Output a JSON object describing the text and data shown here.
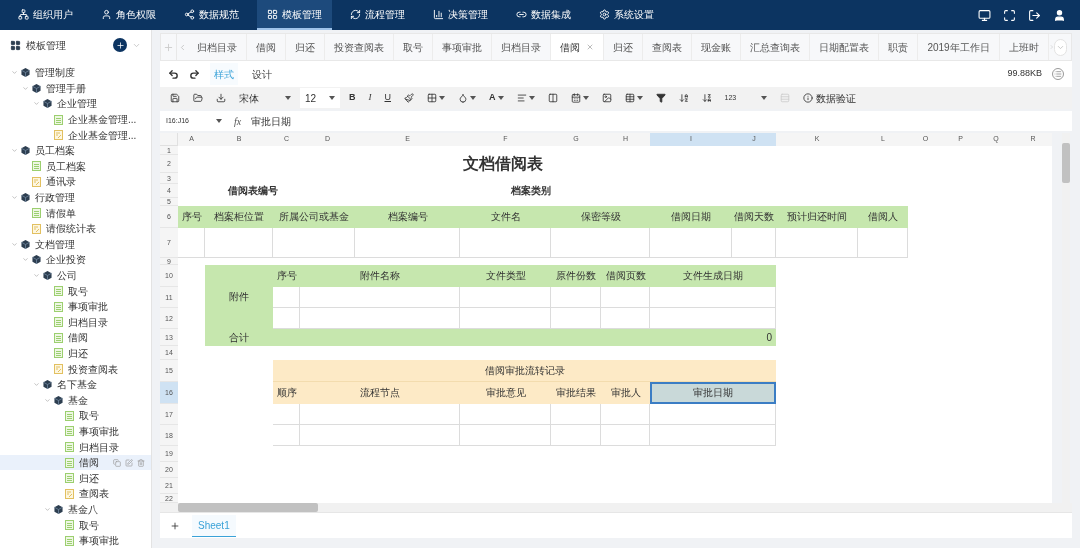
{
  "nav": {
    "items": [
      {
        "label": "组织用户",
        "selected": false
      },
      {
        "label": "角色权限",
        "selected": false
      },
      {
        "label": "数据规范",
        "selected": false
      },
      {
        "label": "模板管理",
        "selected": true
      },
      {
        "label": "流程管理",
        "selected": false
      },
      {
        "label": "决策管理",
        "selected": false
      },
      {
        "label": "数据集成",
        "selected": false
      },
      {
        "label": "系统设置",
        "selected": false
      }
    ]
  },
  "sidebar": {
    "title": "模板管理",
    "tree": [
      {
        "label": "管理制度",
        "kind": "folder",
        "expanded": true,
        "selected": false,
        "children": [
          {
            "label": "管理手册",
            "kind": "folder",
            "expanded": true,
            "selected": false,
            "children": [
              {
                "label": "企业管理",
                "kind": "folder",
                "expanded": true,
                "selected": false,
                "children": [
                  {
                    "label": "企业基金管理...",
                    "kind": "sheet",
                    "selected": false
                  },
                  {
                    "label": "企业基金管理...",
                    "kind": "form",
                    "selected": false
                  }
                ]
              }
            ]
          }
        ]
      },
      {
        "label": "员工档案",
        "kind": "folder",
        "expanded": true,
        "selected": false,
        "children": [
          {
            "label": "员工档案",
            "kind": "sheet",
            "selected": false
          },
          {
            "label": "通讯录",
            "kind": "form",
            "selected": false
          }
        ]
      },
      {
        "label": "行政管理",
        "kind": "folder",
        "expanded": true,
        "selected": false,
        "children": [
          {
            "label": "请假单",
            "kind": "sheet",
            "selected": false
          },
          {
            "label": "请假统计表",
            "kind": "form",
            "selected": false
          }
        ]
      },
      {
        "label": "文档管理",
        "kind": "folder",
        "expanded": true,
        "selected": false,
        "children": [
          {
            "label": "企业投资",
            "kind": "folder",
            "expanded": true,
            "selected": false,
            "children": [
              {
                "label": "公司",
                "kind": "folder",
                "expanded": true,
                "selected": false,
                "children": [
                  {
                    "label": "取号",
                    "kind": "sheet",
                    "selected": false
                  },
                  {
                    "label": "事项审批",
                    "kind": "sheet",
                    "selected": false
                  },
                  {
                    "label": "归档目录",
                    "kind": "sheet",
                    "selected": false
                  },
                  {
                    "label": "借阅",
                    "kind": "sheet",
                    "selected": false
                  },
                  {
                    "label": "归还",
                    "kind": "sheet",
                    "selected": false
                  },
                  {
                    "label": "投资查阅表",
                    "kind": "form",
                    "selected": false
                  }
                ]
              },
              {
                "label": "名下基金",
                "kind": "folder",
                "expanded": true,
                "selected": false,
                "children": [
                  {
                    "label": "基金",
                    "kind": "folder",
                    "expanded": true,
                    "selected": false,
                    "children": [
                      {
                        "label": "取号",
                        "kind": "sheet",
                        "selected": false
                      },
                      {
                        "label": "事项审批",
                        "kind": "sheet",
                        "selected": false
                      },
                      {
                        "label": "归档目录",
                        "kind": "sheet",
                        "selected": false
                      },
                      {
                        "label": "借阅",
                        "kind": "sheet",
                        "selected": true
                      },
                      {
                        "label": "归还",
                        "kind": "sheet",
                        "selected": false
                      },
                      {
                        "label": "查阅表",
                        "kind": "form",
                        "selected": false
                      }
                    ]
                  },
                  {
                    "label": "基金八",
                    "kind": "folder",
                    "expanded": true,
                    "selected": false,
                    "children": [
                      {
                        "label": "取号",
                        "kind": "sheet",
                        "selected": false
                      },
                      {
                        "label": "事项审批",
                        "kind": "sheet",
                        "selected": false
                      }
                    ]
                  }
                ]
              }
            ]
          }
        ]
      }
    ]
  },
  "tabs": {
    "items": [
      {
        "label": "归档目录",
        "selected": false
      },
      {
        "label": "借阅",
        "selected": false
      },
      {
        "label": "归还",
        "selected": false
      },
      {
        "label": "投资查阅表",
        "selected": false
      },
      {
        "label": "取号",
        "selected": false
      },
      {
        "label": "事项审批",
        "selected": false
      },
      {
        "label": "归档目录",
        "selected": false
      },
      {
        "label": "借阅",
        "selected": true
      },
      {
        "label": "归还",
        "selected": false
      },
      {
        "label": "查阅表",
        "selected": false
      },
      {
        "label": "现金账",
        "selected": false
      },
      {
        "label": "汇总查询表",
        "selected": false
      },
      {
        "label": "日期配置表",
        "selected": false
      },
      {
        "label": "职责",
        "selected": false
      },
      {
        "label": "2019年工作日",
        "selected": false
      },
      {
        "label": "上班时",
        "selected": false
      }
    ]
  },
  "modes": [
    {
      "label": "样式",
      "selected": true
    },
    {
      "label": "设计",
      "selected": false
    }
  ],
  "file_size": "99.88KB",
  "toolbar": {
    "font": "宋体",
    "font_size": "12",
    "bold": "B",
    "italic": "I",
    "underline": "U",
    "font_color": "A",
    "number_format": "123",
    "validation": "数据验证"
  },
  "formula_bar": {
    "cell_ref": "I16:J16",
    "fx": "fx",
    "value": "审批日期"
  },
  "sheet": {
    "column_headers": [
      {
        "label": "A",
        "selected": false
      },
      {
        "label": "B",
        "selected": false
      },
      {
        "label": "C",
        "selected": false
      },
      {
        "label": "D",
        "selected": false
      },
      {
        "label": "E",
        "selected": false
      },
      {
        "label": "F",
        "selected": false
      },
      {
        "label": "G",
        "selected": false
      },
      {
        "label": "H",
        "selected": false
      },
      {
        "label": "I",
        "selected": true
      },
      {
        "label": "J",
        "selected": true
      },
      {
        "label": "K",
        "selected": false
      },
      {
        "label": "L",
        "selected": false
      },
      {
        "label": "O",
        "selected": false
      },
      {
        "label": "P",
        "selected": false
      },
      {
        "label": "Q",
        "selected": false
      },
      {
        "label": "R",
        "selected": false
      }
    ],
    "row_headers": [
      {
        "label": "1",
        "selected": false
      },
      {
        "label": "2",
        "selected": false
      },
      {
        "label": "3",
        "selected": false
      },
      {
        "label": "4",
        "selected": false
      },
      {
        "label": "5",
        "selected": false
      },
      {
        "label": "6",
        "selected": false
      },
      {
        "label": "7",
        "selected": false
      },
      {
        "label": "9",
        "selected": false
      },
      {
        "label": "10",
        "selected": false
      },
      {
        "label": "11",
        "selected": false
      },
      {
        "label": "12",
        "selected": false
      },
      {
        "label": "13",
        "selected": false
      },
      {
        "label": "14",
        "selected": false
      },
      {
        "label": "15",
        "selected": false
      },
      {
        "label": "16",
        "selected": true
      },
      {
        "label": "17",
        "selected": false
      },
      {
        "label": "18",
        "selected": false
      },
      {
        "label": "19",
        "selected": false
      },
      {
        "label": "20",
        "selected": false
      },
      {
        "label": "21",
        "selected": false
      },
      {
        "label": "22",
        "selected": false
      }
    ],
    "title": "文档借阅表",
    "fields": [
      "借阅表编号",
      "档案类别"
    ],
    "borrow_columns": [
      "序号",
      "档案柜位置",
      "所属公司或基金",
      "档案编号",
      "文件名",
      "保密等级",
      "借阅日期",
      "借阅天数",
      "预计归还时间",
      "借阅人"
    ],
    "attachments": {
      "label": "附件",
      "columns": [
        "序号",
        "附件名称",
        "文件类型",
        "原件份数",
        "借阅页数",
        "文件生成日期"
      ],
      "total_label": "合计",
      "total": "0"
    },
    "approval": {
      "title": "借阅审批流转记录",
      "columns": [
        {
          "label": "顺序",
          "selected": false
        },
        {
          "label": "流程节点",
          "selected": false
        },
        {
          "label": "审批意见",
          "selected": false
        },
        {
          "label": "审批结果",
          "selected": false
        },
        {
          "label": "审批人",
          "selected": false
        },
        {
          "label": "审批日期",
          "selected": true
        }
      ]
    }
  },
  "sheet_tabs": [
    {
      "label": "Sheet1",
      "selected": true
    }
  ]
}
